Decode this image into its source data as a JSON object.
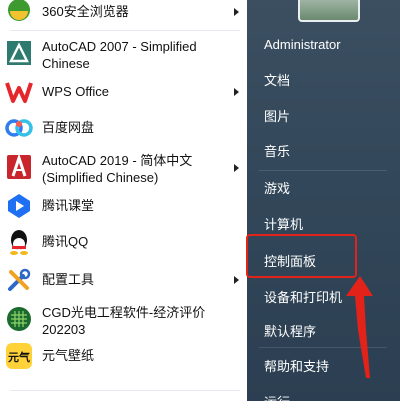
{
  "programs": [
    {
      "label": "360安全浏览器",
      "icon": "360-browser-icon",
      "submenu": true
    },
    {
      "label": "AutoCAD 2007 - Simplified Chinese",
      "icon": "autocad2007-icon",
      "submenu": false
    },
    {
      "label": "WPS Office",
      "icon": "wps-icon",
      "submenu": true
    },
    {
      "label": "百度网盘",
      "icon": "baidu-netdisk-icon",
      "submenu": false
    },
    {
      "label": "AutoCAD 2019 - 简体中文 (Simplified Chinese)",
      "icon": "autocad2019-icon",
      "submenu": true
    },
    {
      "label": "腾讯课堂",
      "icon": "tencent-classroom-icon",
      "submenu": false
    },
    {
      "label": "腾讯QQ",
      "icon": "qq-icon",
      "submenu": false
    },
    {
      "label": "配置工具",
      "icon": "config-tool-icon",
      "submenu": true
    },
    {
      "label": "CGD光电工程软件-经济评价 202203",
      "icon": "cgd-icon",
      "submenu": false
    },
    {
      "label": "元气壁纸",
      "icon": "yuanqi-wallpaper-icon",
      "submenu": false
    }
  ],
  "right_menu": [
    {
      "label": "Administrator"
    },
    {
      "label": "文档"
    },
    {
      "label": "图片"
    },
    {
      "label": "音乐"
    },
    {
      "label": "游戏"
    },
    {
      "label": "计算机"
    },
    {
      "label": "控制面板"
    },
    {
      "label": "设备和打印机"
    },
    {
      "label": "默认程序"
    },
    {
      "label": "帮助和支持"
    },
    {
      "label": "运行"
    }
  ],
  "colors": {
    "highlight": "#e3221a",
    "right_panel": "#33485a",
    "arrow": "#e3221a"
  }
}
